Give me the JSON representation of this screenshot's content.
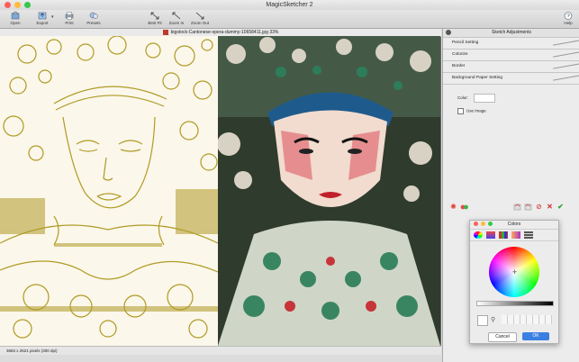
{
  "window": {
    "title": "MagicSketcher 2"
  },
  "toolbar": {
    "open": "Open",
    "export": "Export",
    "print": "Print",
    "presets": "Presets",
    "best_fit": "Best Fit",
    "zoom_in": "Zoom In",
    "zoom_out": "Zoom Out",
    "help": "Help"
  },
  "document": {
    "file_title": "bigstock-Cantonese-opera-dummy-10658411.jpg 33%",
    "status": "3683 x 2521 pixels (300 dpi)"
  },
  "panel": {
    "title": "Sketch Adjustments",
    "sections": [
      "Pencil Setting",
      "Colorize",
      "Border",
      "Background Paper Setting"
    ],
    "color_label": "Color:",
    "use_image_label": "Use Image"
  },
  "colors_window": {
    "title": "Colors",
    "cancel_label": "Cancel",
    "ok_label": "OK"
  },
  "icons": {
    "open": "open-icon",
    "export": "export-icon",
    "print": "print-icon",
    "presets": "presets-icon",
    "best_fit": "best-fit-icon",
    "zoom_in": "zoom-in-icon",
    "zoom_out": "zoom-out-icon",
    "help": "help-icon"
  },
  "colors": {
    "accent": "#3b7fe0",
    "sketch_ink": "#b09a25",
    "close": "#fc605b",
    "minimize": "#fdbc40",
    "zoom": "#34c84a"
  }
}
